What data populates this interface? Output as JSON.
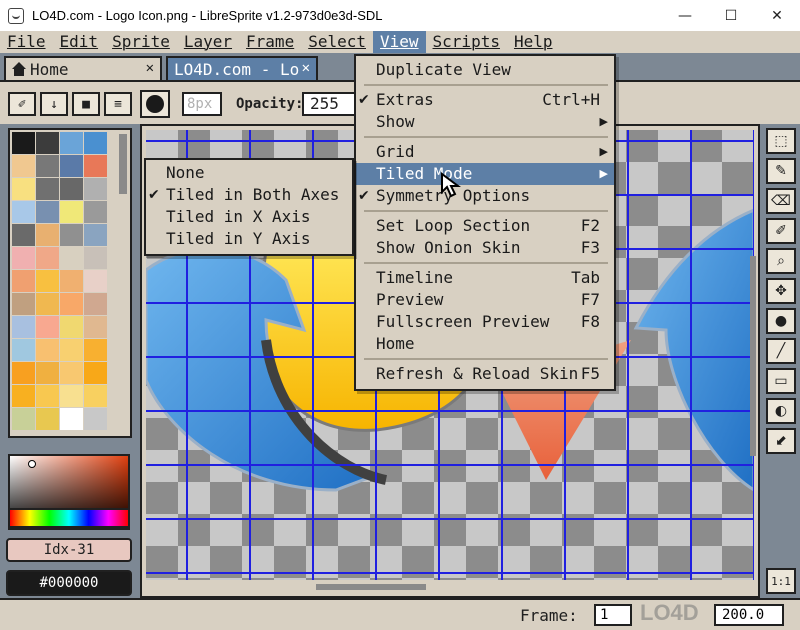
{
  "window": {
    "title": "LO4D.com - Logo Icon.png - LibreSprite v1.2-973d0e3d-SDL",
    "minimize": "—",
    "maximize": "☐",
    "close": "✕"
  },
  "menubar": [
    "File",
    "Edit",
    "Sprite",
    "Layer",
    "Frame",
    "Select",
    "View",
    "Scripts",
    "Help"
  ],
  "tabs": {
    "home": {
      "label": "Home",
      "close": "✕"
    },
    "document": {
      "label": "LO4D.com - Lo",
      "close": "✕"
    }
  },
  "toolbar": {
    "brush_size": "8px",
    "opacity_label": "Opacity:",
    "opacity_value": "255",
    "buttons": [
      "✐",
      "↓",
      "■",
      "≡"
    ]
  },
  "palette": {
    "colors": [
      "#1a1a1a",
      "#3c3c3c",
      "#6aa4d8",
      "#4a90d0",
      "#f0c890",
      "#787878",
      "#5a7aa8",
      "#e87858",
      "#f8e080",
      "#707070",
      "#686868",
      "#b0b0b0",
      "#a8c8e8",
      "#7890b0",
      "#f0e878",
      "#9a9a9a",
      "#6a6a6a",
      "#e8b070",
      "#909090",
      "#8aa4c0",
      "#f0b0b0",
      "#f0a888",
      "#d8d0c0",
      "#c8c0b8",
      "#f0a070",
      "#f8c040",
      "#f0b070",
      "#e8d0c8",
      "#c0a080",
      "#f0b850",
      "#f8a868",
      "#d0a890",
      "#a8c0e0",
      "#f8a890",
      "#f0d870",
      "#e0b890",
      "#a0c8e0",
      "#f8c070",
      "#f8d070",
      "#f8b030",
      "#f8a020",
      "#f0b040",
      "#f8c870",
      "#f8a818",
      "#f8b020",
      "#f8c850",
      "#f8e090",
      "#f8d060",
      "#c8d098",
      "#e8c850",
      "#ffffff",
      "#c8c8c8"
    ],
    "index_label": "Idx-31",
    "hex_label": "#000000"
  },
  "view_menu": {
    "items": [
      {
        "label": "Duplicate View",
        "shortcut": "",
        "submenu": false,
        "checked": false,
        "highlighted": false
      },
      {
        "sep": true
      },
      {
        "label": "Extras",
        "shortcut": "Ctrl+H",
        "submenu": false,
        "checked": true,
        "highlighted": false
      },
      {
        "label": "Show",
        "shortcut": "",
        "submenu": true,
        "checked": false,
        "highlighted": false
      },
      {
        "sep": true
      },
      {
        "label": "Grid",
        "shortcut": "",
        "submenu": true,
        "checked": false,
        "highlighted": false
      },
      {
        "label": "Tiled Mode",
        "shortcut": "",
        "submenu": true,
        "checked": false,
        "highlighted": true
      },
      {
        "label": "Symmetry Options",
        "shortcut": "",
        "submenu": false,
        "checked": true,
        "highlighted": false
      },
      {
        "sep": true
      },
      {
        "label": "Set Loop Section",
        "shortcut": "F2",
        "submenu": false,
        "checked": false,
        "highlighted": false
      },
      {
        "label": "Show Onion Skin",
        "shortcut": "F3",
        "submenu": false,
        "checked": false,
        "highlighted": false
      },
      {
        "sep": true
      },
      {
        "label": "Timeline",
        "shortcut": "Tab",
        "submenu": false,
        "checked": false,
        "highlighted": false
      },
      {
        "label": "Preview",
        "shortcut": "F7",
        "submenu": false,
        "checked": false,
        "highlighted": false
      },
      {
        "label": "Fullscreen Preview",
        "shortcut": "F8",
        "submenu": false,
        "checked": false,
        "highlighted": false
      },
      {
        "label": "Home",
        "shortcut": "",
        "submenu": false,
        "checked": false,
        "highlighted": false
      },
      {
        "sep": true
      },
      {
        "label": "Refresh & Reload Skin",
        "shortcut": "F5",
        "submenu": false,
        "checked": false,
        "highlighted": false
      }
    ]
  },
  "tiled_menu": {
    "items": [
      {
        "label": "None",
        "checked": false
      },
      {
        "label": "Tiled in Both Axes",
        "checked": true
      },
      {
        "label": "Tiled in X Axis",
        "checked": false
      },
      {
        "label": "Tiled in Y Axis",
        "checked": false
      }
    ]
  },
  "tools": [
    "⬚",
    "✎",
    "⌫",
    "✐",
    "⌕",
    "✥",
    "●",
    "╱",
    "▭",
    "◐",
    "⬋"
  ],
  "zoom_fit": "1:1",
  "status": {
    "frame_label": "Frame:",
    "frame_value": "1",
    "zoom_value": "200.0",
    "watermark": "LO4D"
  },
  "colors": {
    "menu_bg": "#d8d0c2",
    "highlight": "#5d7fa6",
    "workspace": "#7d8894",
    "grid": "#2020e0"
  }
}
